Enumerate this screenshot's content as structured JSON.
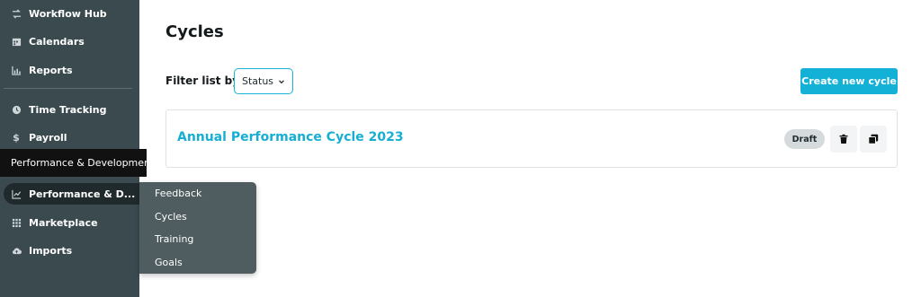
{
  "sidebar": {
    "items": [
      {
        "label": "Workflow Hub",
        "icon": "workflow-icon"
      },
      {
        "label": "Calendars",
        "icon": "calendar-icon"
      },
      {
        "label": "Reports",
        "icon": "chart-icon"
      },
      {
        "label": "Time Tracking",
        "icon": "clock-icon"
      },
      {
        "label": "Payroll",
        "icon": "dollar-icon"
      },
      {
        "label": "Performance & D...",
        "icon": "trend-icon"
      },
      {
        "label": "Marketplace",
        "icon": "grid-icon"
      },
      {
        "label": "Imports",
        "icon": "cloud-upload-icon"
      }
    ],
    "tooltip": "Performance & Development",
    "submenu": [
      "Feedback",
      "Cycles",
      "Training",
      "Goals"
    ]
  },
  "main": {
    "title": "Cycles",
    "filter_label": "Filter list by",
    "status_select": "Status",
    "create_button": "Create new cycle",
    "cycle": {
      "title": "Annual Performance Cycle 2023",
      "status_badge": "Draft"
    }
  },
  "colors": {
    "sidebar": "#3a4a4f",
    "accent": "#13b1d6",
    "active_item": "#202a2d",
    "submenu": "#4f5c60"
  }
}
